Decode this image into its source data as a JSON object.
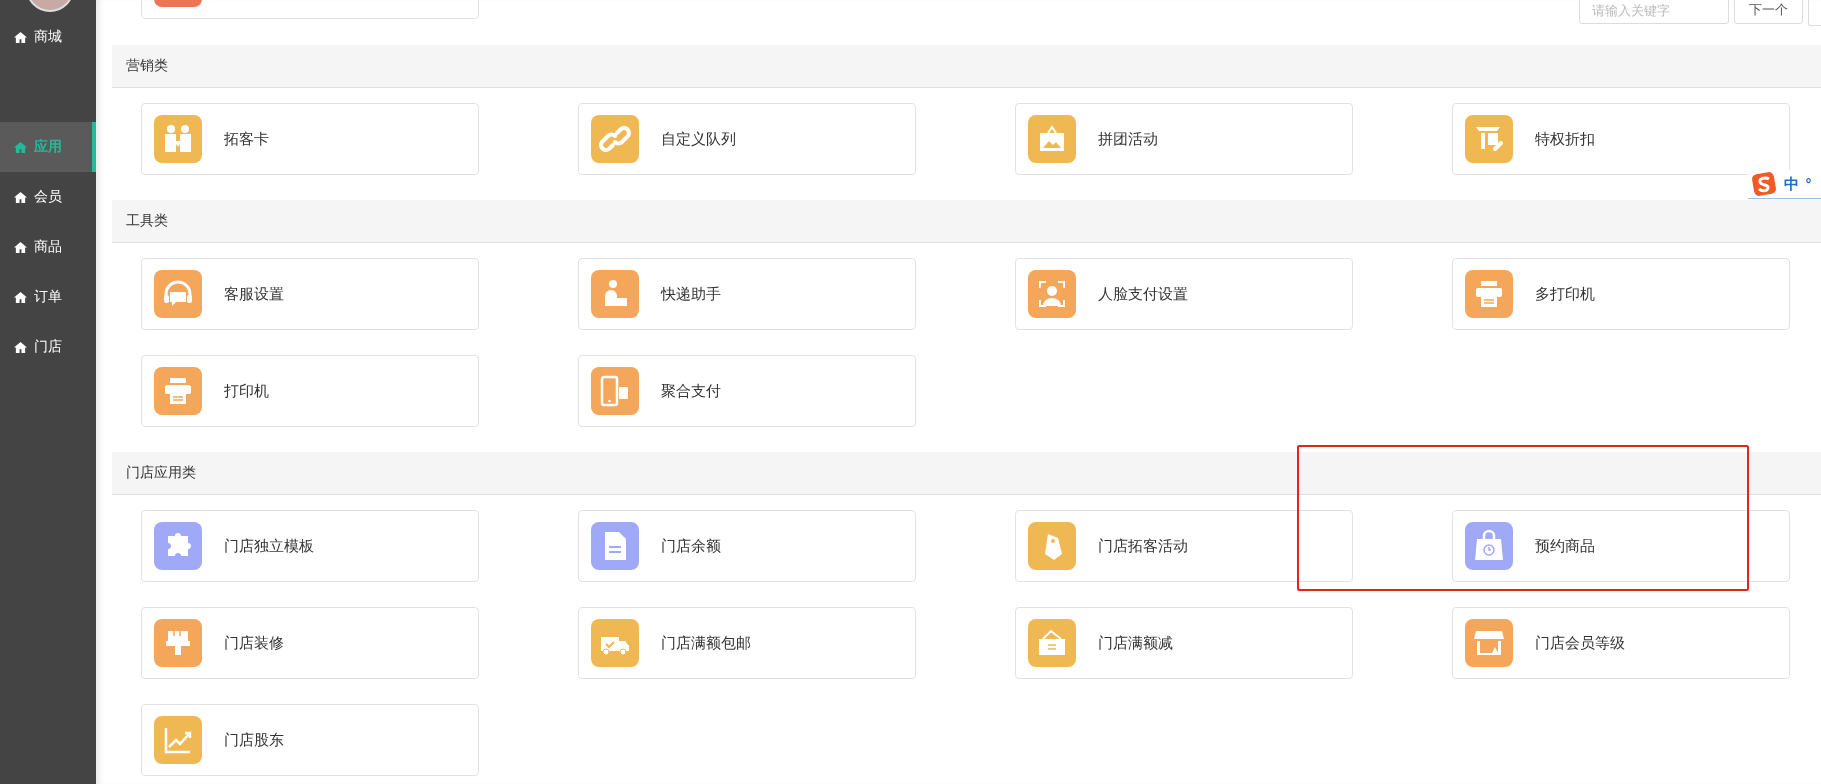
{
  "sidebar": {
    "items": [
      {
        "label": "商城",
        "selected": false
      },
      {
        "label": "应用",
        "selected": true
      },
      {
        "label": "会员",
        "selected": false
      },
      {
        "label": "商品",
        "selected": false
      },
      {
        "label": "订单",
        "selected": false
      },
      {
        "label": "门店",
        "selected": false
      }
    ]
  },
  "partial_card": {
    "color": "#ef7454"
  },
  "search": {
    "placeholder": "请输入关键字",
    "buttons": [
      "下一个"
    ]
  },
  "sections": [
    {
      "title": "营销类",
      "cards": [
        {
          "label": "拓客卡",
          "color": "#f0b852",
          "highlighted": false
        },
        {
          "label": "自定义队列",
          "color": "#f0b852",
          "highlighted": false
        },
        {
          "label": "拼团活动",
          "color": "#f0b852",
          "highlighted": false
        },
        {
          "label": "特权折扣",
          "color": "#f0b852",
          "highlighted": false
        }
      ]
    },
    {
      "title": "工具类",
      "cards": [
        {
          "label": "客服设置",
          "color": "#f4a65a",
          "highlighted": false
        },
        {
          "label": "快递助手",
          "color": "#f4a65a",
          "highlighted": false
        },
        {
          "label": "人脸支付设置",
          "color": "#f4a65a",
          "highlighted": false
        },
        {
          "label": "多打印机",
          "color": "#f4a65a",
          "highlighted": false
        },
        {
          "label": "打印机",
          "color": "#f4a65a",
          "highlighted": false
        },
        {
          "label": "聚合支付",
          "color": "#f4a65a",
          "highlighted": false
        }
      ]
    },
    {
      "title": "门店应用类",
      "cards": [
        {
          "label": "门店独立模板",
          "color": "#a0a9f8",
          "highlighted": false
        },
        {
          "label": "门店余额",
          "color": "#a0a9f8",
          "highlighted": false
        },
        {
          "label": "门店拓客活动",
          "color": "#f0b852",
          "highlighted": false
        },
        {
          "label": "预约商品",
          "color": "#a0a9f8",
          "highlighted": true
        },
        {
          "label": "门店装修",
          "color": "#f4a65a",
          "highlighted": false
        },
        {
          "label": "门店满额包邮",
          "color": "#f0b852",
          "highlighted": false
        },
        {
          "label": "门店满额减",
          "color": "#f0b852",
          "highlighted": false
        },
        {
          "label": "门店会员等级",
          "color": "#f4a65a",
          "highlighted": false
        },
        {
          "label": "门店股东",
          "color": "#f0b852",
          "highlighted": false
        }
      ]
    }
  ],
  "ime_toolbar": {
    "mode": "中",
    "punctuation": "°"
  }
}
